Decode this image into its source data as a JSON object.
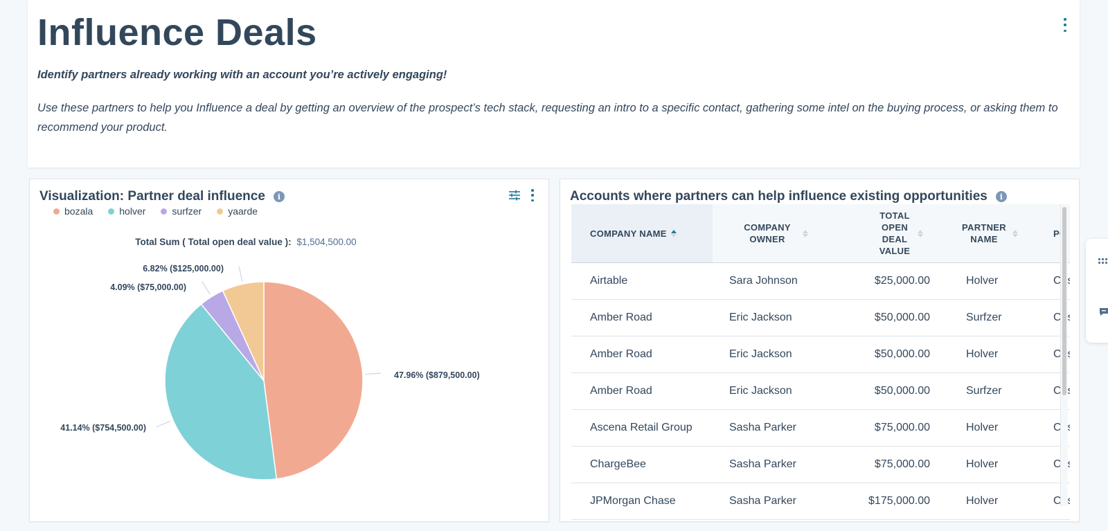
{
  "header": {
    "title": "Influence Deals",
    "subtitle": "Identify partners already working with an account you’re actively engaging!",
    "description": "Use these partners to help you Influence a deal by getting an overview of the prospect’s tech stack, requesting an intro to a specific contact, gathering some intel on the buying process, or asking them to recommend your product."
  },
  "viz": {
    "title": "Visualization: Partner deal influence",
    "info_glyph": "i",
    "total_label": "Total Sum ( Total open deal value ):",
    "total_value": "$1,504,500.00"
  },
  "chart_data": {
    "type": "pie",
    "title": "Visualization: Partner deal influence",
    "legend_position": "top-left",
    "total": 1504500,
    "slices": [
      {
        "name": "bozala",
        "value": 879500,
        "label": "47.96% ($879,500.00)",
        "color": "#f2a991"
      },
      {
        "name": "holver",
        "value": 754500,
        "label": "41.14% ($754,500.00)",
        "color": "#7fd1d8"
      },
      {
        "name": "surfzer",
        "value": 75000,
        "label": "4.09% ($75,000.00)",
        "color": "#b9a8e6"
      },
      {
        "name": "yaarde",
        "value": 125000,
        "label": "6.82% ($125,000.00)",
        "color": "#f2c994"
      }
    ]
  },
  "table": {
    "title": "Accounts where partners can help influence existing opportunities",
    "columns": [
      "COMPANY NAME",
      "COMPANY OWNER",
      "TOTAL OPEN DEAL VALUE",
      "PARTNER NAME",
      "PO"
    ],
    "rows": [
      [
        "Airtable",
        "Sara Johnson",
        "$25,000.00",
        "Holver",
        "Cus"
      ],
      [
        "Amber Road",
        "Eric Jackson",
        "$50,000.00",
        "Surfzer",
        "Cus"
      ],
      [
        "Amber Road",
        "Eric Jackson",
        "$50,000.00",
        "Holver",
        "Cus"
      ],
      [
        "Amber Road",
        "Eric Jackson",
        "$50,000.00",
        "Surfzer",
        "Cus"
      ],
      [
        "Ascena Retail Group",
        "Sasha Parker",
        "$75,000.00",
        "Holver",
        "Cus"
      ],
      [
        "ChargeBee",
        "Sasha Parker",
        "$75,000.00",
        "Holver",
        "Cus"
      ],
      [
        "JPMorgan Chase",
        "Sasha Parker",
        "$175,000.00",
        "Holver",
        "Cus"
      ]
    ]
  },
  "colors": {
    "text": "#33475b",
    "accent": "#1d7a99",
    "info": "#7c98b6"
  },
  "icons": {
    "header_menu": "vertical-dots-icon",
    "viz_filter": "sliders-icon",
    "viz_menu": "vertical-dots-icon",
    "info": "info-icon",
    "side_apps": "grid-icon",
    "side_chat": "chat-icon"
  }
}
